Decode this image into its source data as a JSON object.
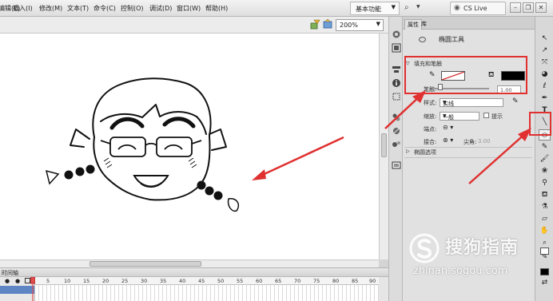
{
  "menu": {
    "items": [
      "编辑(E)",
      "插入(I)",
      "修改(M)",
      "文本(T)",
      "命令(C)",
      "控制(O)",
      "调试(D)",
      "窗口(W)",
      "帮助(H)"
    ],
    "workspace": "基本功能",
    "search": "CS Live",
    "window_buttons": [
      "–",
      "❐",
      "✕"
    ]
  },
  "stage": {
    "zoom": "200%"
  },
  "timeline": {
    "tab_label": "时间轴",
    "frame_numbers": [
      "5",
      "10",
      "15",
      "20",
      "25",
      "30",
      "35",
      "40",
      "45",
      "50",
      "55",
      "60",
      "65",
      "70",
      "75",
      "80",
      "85",
      "90"
    ]
  },
  "panel": {
    "tabs": [
      "属性",
      "库"
    ],
    "tool_name": "椭圆工具",
    "fill_stroke_section": "填充和笔触",
    "stroke_label": "笔触:",
    "stroke_value": "1.00",
    "style_label": "样式:",
    "style_value": "实线",
    "scale_label": "缩放:",
    "scale_value": "一般",
    "hint_label": "提示",
    "cap_label": "端点:",
    "join_label": "接合:",
    "miter_label": "尖角:",
    "miter_value": "3.00",
    "ellipse_options": "椭圆选项"
  },
  "colors": {
    "stroke_color": "#ffffff",
    "fill_color": "#000000",
    "annotation_red": "#e03030"
  },
  "watermark": {
    "brand": "搜狗指南",
    "url": "zhinan.sogou.com"
  }
}
